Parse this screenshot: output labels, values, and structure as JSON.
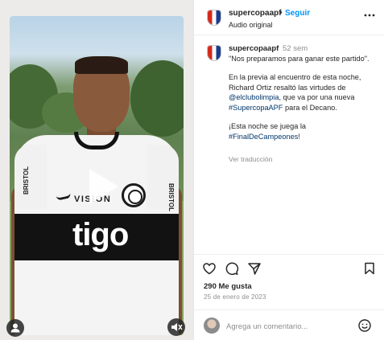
{
  "post": {
    "header": {
      "username": "supercopaapf",
      "separator": "•",
      "follow_label": "Seguir",
      "audio": "Audio original",
      "more_icon": "more-horizontal-icon"
    },
    "caption": {
      "username": "supercopaapf",
      "time": "52 sem",
      "quote": "\"Nos preparamos para ganar este partido\".",
      "para2_part1": "En la previa al encuentro de esta noche, Richard Ortiz resaltó las virtudes de ",
      "para2_mention": "@elclubolimpia",
      "para2_part2": ", que va por una nueva ",
      "para2_hashtag": "#SupercopaAPF",
      "para2_part3": " para el Decano.",
      "para3_part1": "¡Esta noche se juega la ",
      "para3_hashtag": "#FinalDeCampeones",
      "para3_part2": "!",
      "see_translation": "Ver traducción"
    },
    "video": {
      "shirt_sponsor": "tigo",
      "shirt_tech_sponsor": "VISION",
      "sleeve_sponsor": "BRISTOL"
    },
    "stats": {
      "likes": "290 Me gusta",
      "date": "25 de enero de 2023"
    },
    "comment": {
      "placeholder": "Agrega un comentario..."
    },
    "colors": {
      "link": "#0095f6",
      "hashtag": "#00376b",
      "muted": "#8e8e8e",
      "text": "#262626"
    }
  }
}
